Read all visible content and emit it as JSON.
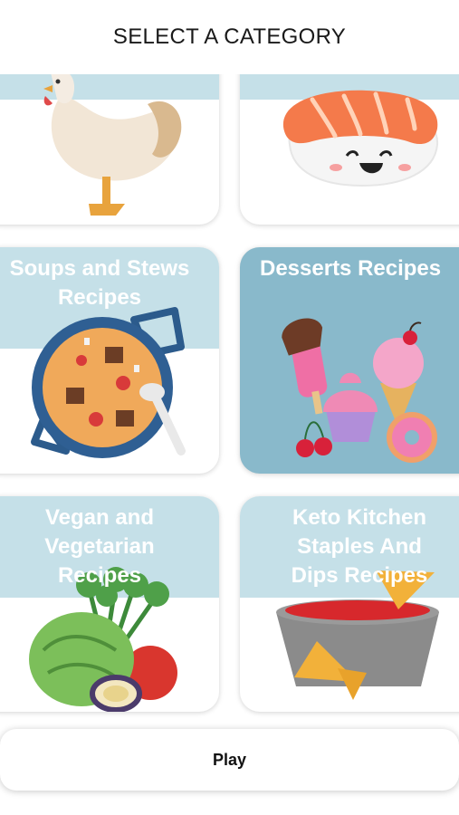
{
  "header": {
    "title": "SELECT A CATEGORY"
  },
  "categories": [
    {
      "title": "",
      "icon": "chicken-icon"
    },
    {
      "title": "",
      "icon": "sushi-icon"
    },
    {
      "title": "Soups and Stews Recipes",
      "icon": "soup-pot-icon"
    },
    {
      "title": "Desserts Recipes",
      "icon": "desserts-icon"
    },
    {
      "title": "Vegan and Vegetarian Recipes",
      "icon": "vegetables-icon"
    },
    {
      "title": "Keto Kitchen Staples And Dips Recipes",
      "icon": "salsa-dip-icon"
    }
  ],
  "play": {
    "label": "Play"
  },
  "colors": {
    "band": "#c5e0e8",
    "selected": "#89b9cb",
    "card": "#ffffff"
  }
}
